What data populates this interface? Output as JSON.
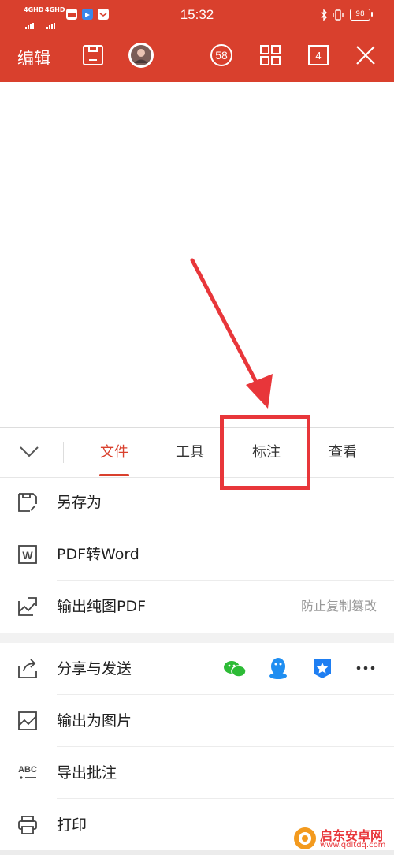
{
  "status_bar": {
    "time": "15:32",
    "network1": "4GHD",
    "network2": "4GHD",
    "battery": "98",
    "colors": {
      "bar": "#d9402d",
      "icon": "#ffffff"
    }
  },
  "toolbar": {
    "edit_label": "编辑",
    "page_count": "58",
    "tab_count": "4",
    "icons": [
      "save-icon",
      "avatar",
      "page-count-badge",
      "grid-view-icon",
      "tabs-count-icon",
      "close-icon"
    ]
  },
  "tabs": [
    {
      "label": "文件",
      "active": true
    },
    {
      "label": "工具",
      "active": false
    },
    {
      "label": "标注",
      "active": false
    },
    {
      "label": "查看",
      "active": false
    }
  ],
  "menu": {
    "save_as": "另存为",
    "pdf_to_word": "PDF转Word",
    "export_image_pdf": "输出纯图PDF",
    "export_image_pdf_hint": "防止复制篡改",
    "share": "分享与发送",
    "export_as_image": "输出为图片",
    "export_annotations": "导出批注",
    "print": "打印"
  },
  "share_targets": [
    "wechat-icon",
    "qq-icon",
    "dingtalk-icon",
    "more-icon"
  ],
  "watermark": {
    "brand": "启东安卓网",
    "url": "www.qdltdq.com"
  },
  "accent_color": "#d9402d",
  "annotation_color": "#e8363a"
}
